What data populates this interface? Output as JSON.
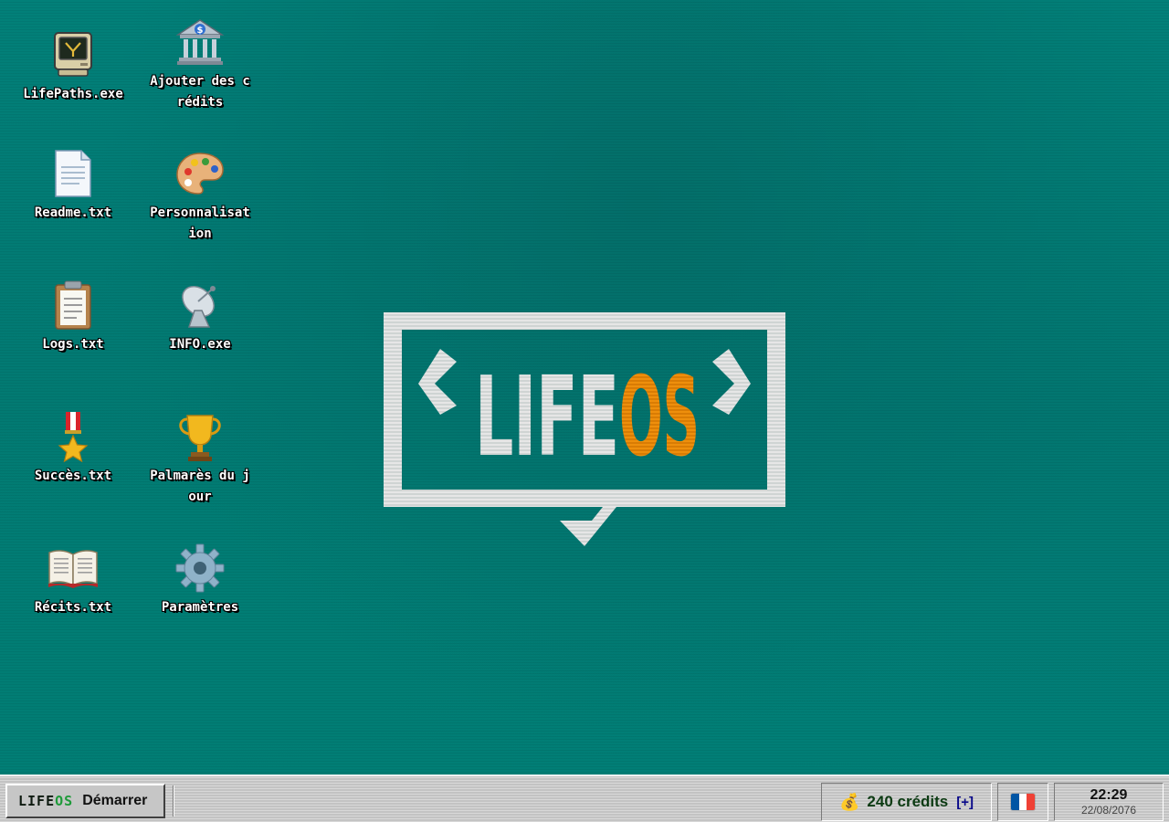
{
  "desktop": {
    "icons": [
      {
        "label": "LifePaths.exe",
        "icon": "retro-computer-icon"
      },
      {
        "label": "Ajouter des crédits",
        "icon": "bank-icon"
      },
      {
        "label": "Readme.txt",
        "icon": "document-icon"
      },
      {
        "label": "Personnalisation",
        "icon": "palette-icon"
      },
      {
        "label": "Logs.txt",
        "icon": "clipboard-icon"
      },
      {
        "label": "INFO.exe",
        "icon": "satellite-dish-icon"
      },
      {
        "label": "Succès.txt",
        "icon": "medal-icon"
      },
      {
        "label": "Palmarès du jour",
        "icon": "trophy-icon"
      },
      {
        "label": "Récits.txt",
        "icon": "open-book-icon"
      },
      {
        "label": "Paramètres",
        "icon": "gear-icon"
      }
    ]
  },
  "logo": {
    "part1": "LIFE",
    "part2": "OS",
    "colors": {
      "frame": "#dcdcdc",
      "life": "#e6e6e6",
      "os": "#e8890c"
    }
  },
  "taskbar": {
    "start": {
      "logo_part1": "LIFE",
      "logo_part2": "OS",
      "label": "Démarrer"
    },
    "credits": {
      "icon": "money-bag-icon",
      "amount": "240 crédits",
      "add_label": "[+]"
    },
    "language": {
      "icon": "flag-france-icon",
      "colors": [
        "#0055a4",
        "#ffffff",
        "#ef4135"
      ]
    },
    "clock": {
      "time": "22:29",
      "date": "22/08/2076"
    }
  }
}
